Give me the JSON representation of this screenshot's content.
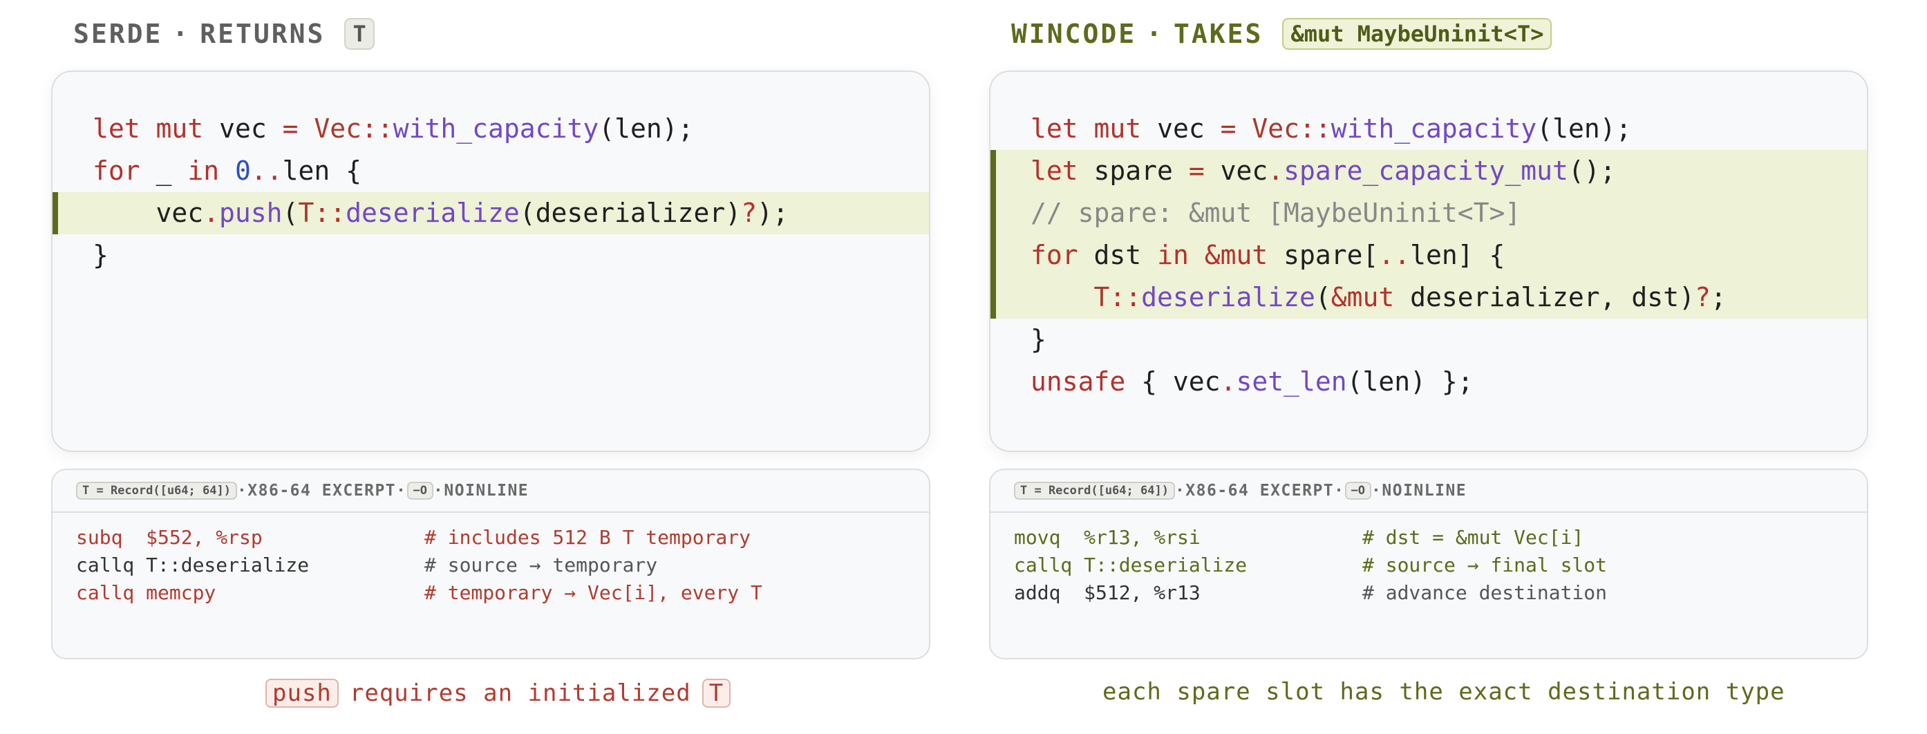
{
  "serde": {
    "title_a": "SERDE",
    "title_sep": "·",
    "title_b": "RETURNS",
    "title_pill": "T",
    "code": {
      "l1": [
        "let",
        "mut",
        "vec",
        "=",
        "Vec",
        "::",
        "with_capacity",
        "(len);"
      ],
      "l2": [
        "for",
        "_",
        "in",
        "0",
        "..",
        "len {"
      ],
      "l3": [
        "vec",
        ".",
        "push",
        "(",
        "T",
        "::",
        "deserialize",
        "(deserializer)",
        "?",
        ");"
      ],
      "l4": "}"
    },
    "asm": {
      "tag": "T = Record([u64; 64])",
      "sep": "·",
      "label": "X86-64 EXCERPT",
      "flag": "−O",
      "mode": "NOINLINE",
      "rows": [
        {
          "ins": "subq  $552, %rsp",
          "comment": "# includes 512 B T temporary",
          "color": "#b33a2e"
        },
        {
          "ins": "callq T::deserialize",
          "comment": "# source → temporary",
          "color": "#333333"
        },
        {
          "ins": "callq memcpy",
          "comment": "# temporary → Vec[i], every T",
          "color": "#b33a2e"
        }
      ]
    },
    "caption": {
      "pill": "push",
      "mid": "requires an initialized",
      "pill2": "T"
    }
  },
  "wincode": {
    "title_a": "WINCODE",
    "title_sep": "·",
    "title_b": "TAKES",
    "title_pill": "&mut MaybeUninit<T>",
    "code": {
      "l1": [
        "let",
        "mut",
        "vec",
        "=",
        "Vec",
        "::",
        "with_capacity",
        "(len);"
      ],
      "l2": [
        "let",
        "spare",
        "=",
        "vec",
        ".",
        "spare_capacity_mut",
        "();"
      ],
      "l3": "// spare: &mut [MaybeUninit<T>]",
      "l4": [
        "for",
        "dst",
        "in",
        "&mut",
        "spare[",
        "..",
        "len] {"
      ],
      "l5": [
        "T",
        "::",
        "deserialize",
        "(",
        "&mut",
        "deserializer, dst)",
        "?",
        ";"
      ],
      "l6": "}",
      "l7": [
        "unsafe",
        "{ vec",
        ".",
        "set_len",
        "(len) };"
      ]
    },
    "asm": {
      "tag": "T = Record([u64; 64])",
      "sep": "·",
      "label": "X86-64 EXCERPT",
      "flag": "−O",
      "mode": "NOINLINE",
      "rows": [
        {
          "ins": "movq  %r13, %rsi",
          "comment": "# dst = &mut Vec[i]",
          "color": "#5c6b1c"
        },
        {
          "ins": "callq T::deserialize",
          "comment": "# source → final slot",
          "color": "#5c6b1c"
        },
        {
          "ins": "addq  $512, %r13",
          "comment": "# advance destination",
          "color": "#333333"
        }
      ]
    },
    "caption": "each spare slot has the exact destination type"
  },
  "colors": {
    "accent_green": "#5c6b1c",
    "accent_red": "#b33a2e",
    "keyword": "#b5302c",
    "function": "#7148c7"
  }
}
